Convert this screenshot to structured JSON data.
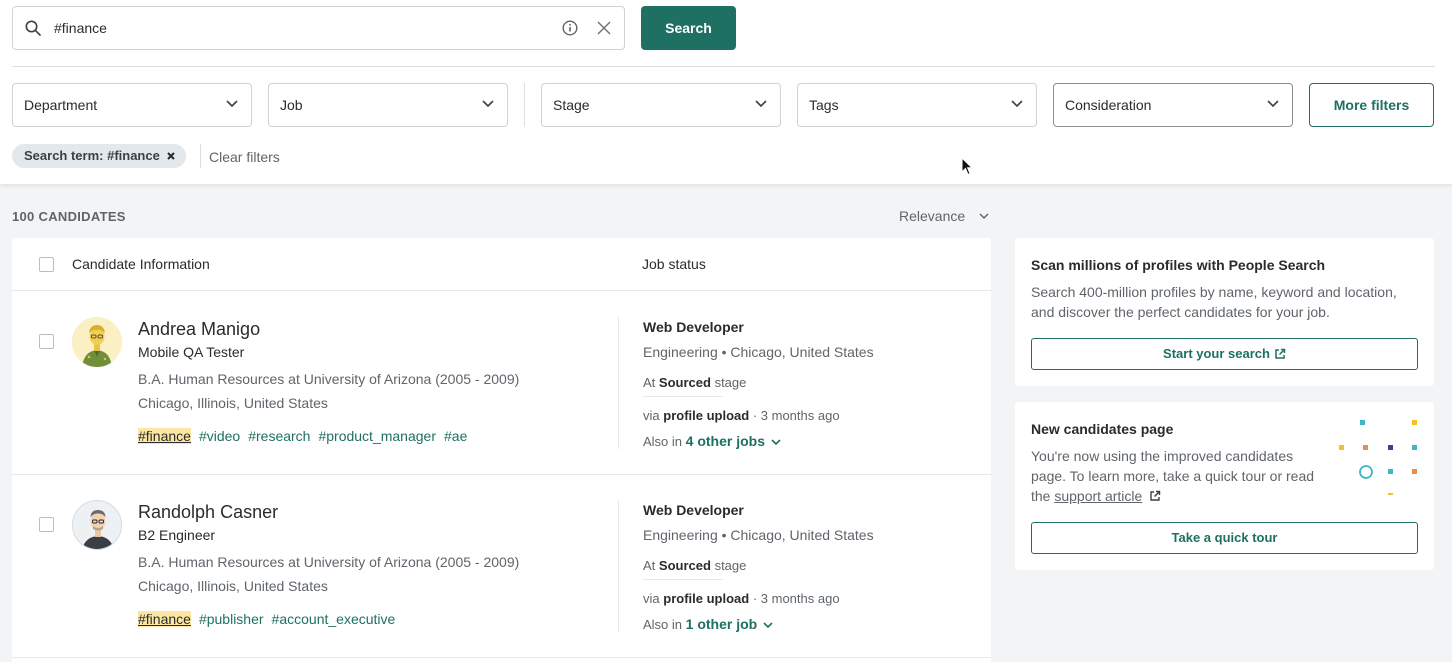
{
  "search": {
    "value": "#finance",
    "button_label": "Search"
  },
  "filters": {
    "dropdowns": [
      "Department",
      "Job",
      "Stage",
      "Tags",
      "Consideration"
    ],
    "more_filters_label": "More filters",
    "chip_label": "Search term: #finance",
    "clear_label": "Clear filters"
  },
  "results": {
    "count_label": "100 CANDIDATES",
    "sort_label": "Relevance"
  },
  "table": {
    "col_candidate": "Candidate Information",
    "col_job": "Job status"
  },
  "candidates": [
    {
      "name": "Andrea Manigo",
      "title": "Mobile QA Tester",
      "education": "B.A. Human Resources at University of Arizona (2005 - 2009)",
      "location": "Chicago, Illinois, United States",
      "tags": [
        "#finance",
        "#video",
        "#research",
        "#product_manager",
        "#ae"
      ],
      "job": {
        "title": "Web Developer",
        "meta": "Engineering • Chicago, United States",
        "stage_prefix": "At",
        "stage": "Sourced",
        "stage_suffix": "stage",
        "via_prefix": "via",
        "via": "profile upload",
        "via_time": "· 3 months ago",
        "also_prefix": "Also in",
        "also_link": "4 other jobs"
      }
    },
    {
      "name": "Randolph Casner",
      "title": "B2 Engineer",
      "education": "B.A. Human Resources at University of Arizona (2005 - 2009)",
      "location": "Chicago, Illinois, United States",
      "tags": [
        "#finance",
        "#publisher",
        "#account_executive"
      ],
      "job": {
        "title": "Web Developer",
        "meta": "Engineering • Chicago, United States",
        "stage_prefix": "At",
        "stage": "Sourced",
        "stage_suffix": "stage",
        "via_prefix": "via",
        "via": "profile upload",
        "via_time": "· 3 months ago",
        "also_prefix": "Also in",
        "also_link": "1 other job"
      }
    }
  ],
  "sidebar": {
    "people_search": {
      "title": "Scan millions of profiles with People Search",
      "text": "Search 400-million profiles by name, keyword and location, and discover the perfect candidates for your job.",
      "button": "Start your search"
    },
    "new_page": {
      "title": "New candidates page",
      "text_before": "You're now using the improved candidates page. To learn more, take a quick tour or read the",
      "link": "support article",
      "button": "Take a quick tour"
    }
  },
  "colors": {
    "accent": "#1e7062",
    "highlight": "#fbe7a3"
  }
}
